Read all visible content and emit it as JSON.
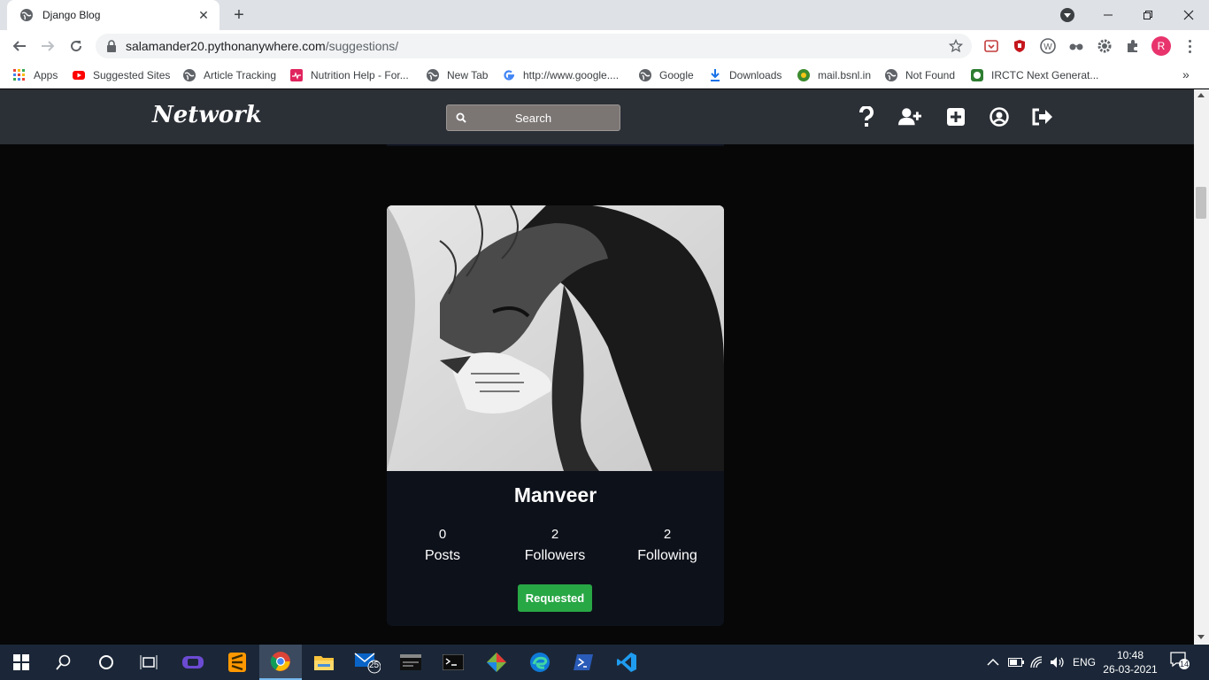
{
  "browser": {
    "tab": {
      "title": "Django Blog",
      "close_glyph": "✕"
    },
    "new_tab_glyph": "+",
    "url": {
      "host": "salamander20.pythonanywhere.com",
      "path": "/suggestions/"
    },
    "avatar_letter": "R",
    "bookmarks": [
      {
        "label": "Apps",
        "icon": "apps-grid-icon"
      },
      {
        "label": "Suggested Sites",
        "icon": "youtube-icon"
      },
      {
        "label": "Article Tracking",
        "icon": "globe-icon"
      },
      {
        "label": "Nutrition Help - For...",
        "icon": "heart-monitor-icon"
      },
      {
        "label": "New Tab",
        "icon": "globe-icon"
      },
      {
        "label": "http://www.google....",
        "icon": "google-icon"
      },
      {
        "label": "Google",
        "icon": "globe-icon"
      },
      {
        "label": "Downloads",
        "icon": "download-icon"
      },
      {
        "label": "mail.bsnl.in",
        "icon": "bsnl-icon"
      },
      {
        "label": "Not Found",
        "icon": "globe-icon"
      },
      {
        "label": "IRCTC Next Generat...",
        "icon": "irctc-icon"
      }
    ],
    "bookmarks_more": "»"
  },
  "site": {
    "brand": "Network",
    "search_placeholder": "Search",
    "nav_icons": [
      "question-icon",
      "add-user-icon",
      "new-post-icon",
      "profile-icon",
      "logout-icon"
    ]
  },
  "profile_card": {
    "name": "Manveer",
    "stats": [
      {
        "value": "0",
        "label": "Posts"
      },
      {
        "value": "2",
        "label": "Followers"
      },
      {
        "value": "2",
        "label": "Following"
      }
    ],
    "button_label": "Requested",
    "accent_color": "#28a745"
  },
  "taskbar": {
    "mail_badge": "25",
    "language": "ENG",
    "time": "10:48",
    "date": "26-03-2021",
    "notification_count": "14"
  }
}
